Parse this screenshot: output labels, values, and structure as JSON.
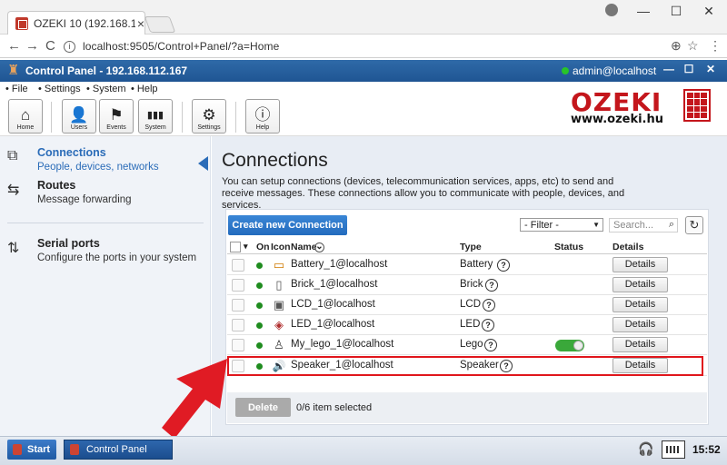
{
  "browser": {
    "tab_title": "OZEKI 10 (192.168.112.16",
    "tab_close": "×",
    "url": "localhost:9505/Control+Panel/?a=Home",
    "back": "←",
    "forward": "→",
    "reload": "C",
    "info": "i",
    "translate": "⊕",
    "star": "☆",
    "menu": "⋮",
    "minimize": "—",
    "maximize": "☐",
    "close": "✕"
  },
  "app": {
    "title": "Control Panel - 192.168.112.167",
    "user": "admin@localhost",
    "logo_glyph": "♜",
    "ctl_minimize": "—",
    "ctl_maximize": "☐",
    "ctl_close": "✕"
  },
  "menu": {
    "file": "• File",
    "settings": "• Settings",
    "system": "• System",
    "help": "• Help"
  },
  "toolbar": {
    "home": {
      "label": "Home",
      "icon": "⌂"
    },
    "users": {
      "label": "Users",
      "icon": "👤"
    },
    "events": {
      "label": "Events",
      "icon": "⚑"
    },
    "system": {
      "label": "System",
      "icon": "▮▮▮"
    },
    "settings": {
      "label": "Settings",
      "icon": "⚙"
    },
    "help": {
      "label": "Help",
      "icon": "ⓘ"
    }
  },
  "brand": {
    "word": "OZEKI",
    "site": "www.ozeki.hu",
    "color": "#c4161c"
  },
  "sidebar": {
    "items": [
      {
        "title": "Connections",
        "subtitle": "People, devices, networks",
        "icon": "⧉"
      },
      {
        "title": "Routes",
        "subtitle": "Message forwarding",
        "icon": "⇆"
      },
      {
        "title": "Serial ports",
        "subtitle": "Configure the ports in your system",
        "icon": "⇅"
      }
    ]
  },
  "main": {
    "title": "Connections",
    "description": "You can setup connections (devices, telecommunication services, apps, etc) to send and receive messages. These connections allow you to communicate with people, devices, and services.",
    "create_button": "Create new Connection",
    "filter": "- Filter -",
    "filter_arrow": "▼",
    "search_placeholder": "Search...",
    "search_icon": "⌕",
    "refresh_icon": "↻",
    "columns": {
      "sort": "▾",
      "on": "On",
      "icon": "Icon",
      "name": "Name",
      "name_sort": "⌄",
      "type": "Type",
      "status": "Status",
      "details": "Details"
    },
    "rows": [
      {
        "name": "Battery_1@localhost",
        "type": "Battery",
        "icon": "▭",
        "details": "Details",
        "q": "?"
      },
      {
        "name": "Brick_1@localhost",
        "type": "Brick",
        "icon": "▯",
        "details": "Details",
        "q": "?"
      },
      {
        "name": "LCD_1@localhost",
        "type": "LCD",
        "icon": "▣",
        "details": "Details",
        "q": "?"
      },
      {
        "name": "LED_1@localhost",
        "type": "LED",
        "icon": "◈",
        "details": "Details",
        "q": "?"
      },
      {
        "name": "My_lego_1@localhost",
        "type": "Lego",
        "icon": "♙",
        "details": "Details",
        "q": "?"
      },
      {
        "name": "Speaker_1@localhost",
        "type": "Speaker",
        "icon": "🔊",
        "details": "Details",
        "q": "?"
      }
    ],
    "delete_button": "Delete",
    "selection": "0/6 item selected"
  },
  "taskbar": {
    "start": "Start",
    "control_panel": "Control Panel",
    "clock": "15:52",
    "headset": "🎧"
  }
}
